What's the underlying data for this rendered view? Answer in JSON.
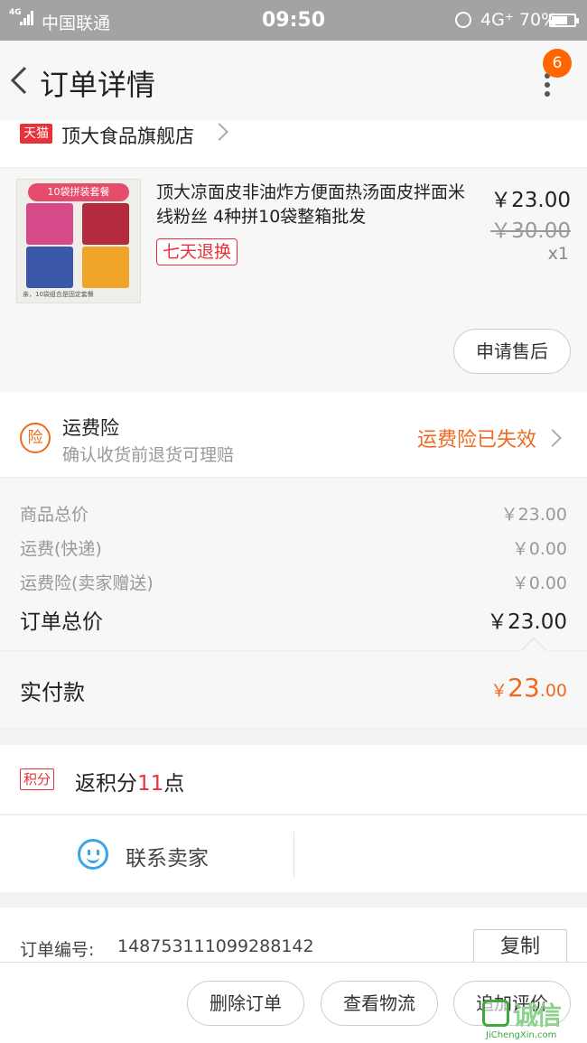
{
  "status_bar": {
    "network_type": "4G",
    "carrier": "中国联通",
    "time": "09:50",
    "network_right": "4G",
    "battery": "70%",
    "battery_level": 0.7
  },
  "nav": {
    "back_icon": "chevron-left-icon",
    "title": "订单详情",
    "more_icon": "more-vertical-icon",
    "badge": "6"
  },
  "store": {
    "platform_badge": "天猫",
    "name": "顶大食品旗舰店"
  },
  "product": {
    "image_lettering": {
      "top": "10袋拼装套餐",
      "note": "亲，10袋组合是固定套餐"
    },
    "name": "顶大凉面皮非油炸方便面热汤面皮拌面米线粉丝 4种拼10袋整箱批发",
    "return_policy": "七天退换",
    "price": "￥23.00",
    "original_price": "￥30.00",
    "quantity": "x1",
    "after_sale_button": "申请售后"
  },
  "insurance": {
    "icon_char": "险",
    "title": "运费险",
    "subtitle": "确认收货前退货可理赔",
    "status": "运费险已失效"
  },
  "costs": {
    "rows": [
      {
        "label": "商品总价",
        "value": "￥23.00"
      },
      {
        "label": "运费(快递)",
        "value": "￥0.00"
      },
      {
        "label": "运费险(卖家赠送)",
        "value": "￥0.00"
      }
    ],
    "total_label": "订单总价",
    "total_value": "￥23.00"
  },
  "paid": {
    "label": "实付款",
    "currency": "￥",
    "integer": "23",
    "decimal": ".00"
  },
  "points": {
    "tag": "积分",
    "prefix": "返积分",
    "number": "11",
    "suffix": "点"
  },
  "contact": {
    "label": "联系卖家"
  },
  "order": {
    "label": "订单编号:",
    "number": "148753111099288142",
    "copy_button": "复制"
  },
  "footer": {
    "delete_button": "删除订单",
    "logistics_button": "查看物流",
    "review_button": "追加评价"
  },
  "watermark": {
    "text": "诚信",
    "url": "JiChengXin.com"
  },
  "colors": {
    "accent_orange": "#f06a1e",
    "tmall_red": "#e8313b",
    "contact_blue": "#3aa5e8",
    "badge_orange": "#ff6600"
  }
}
